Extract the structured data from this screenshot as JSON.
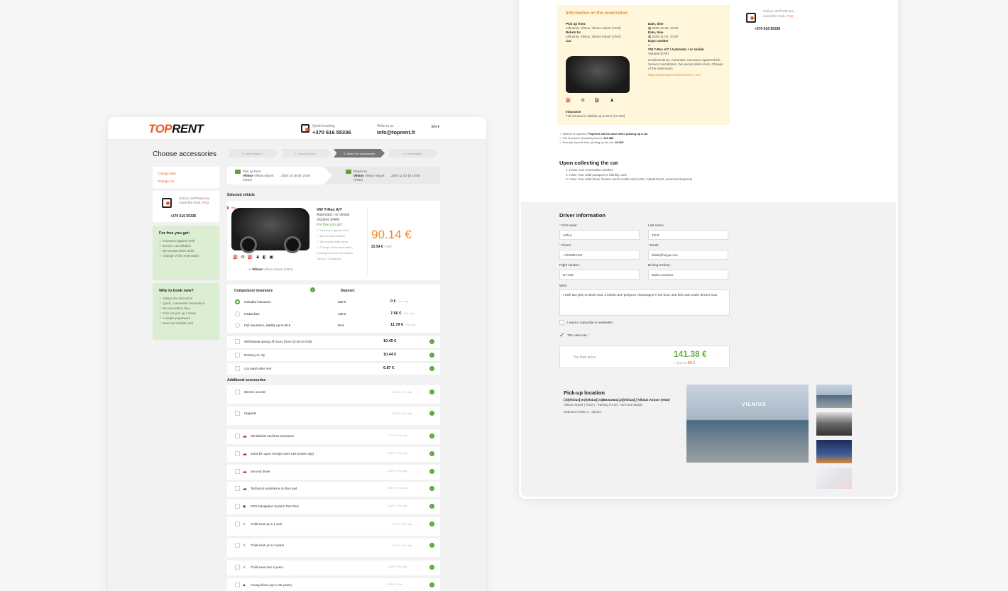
{
  "left": {
    "logo": {
      "a": "TOP",
      "b": "RENT"
    },
    "header": {
      "quick_label": "Quick booking",
      "quick_phone": "+370 616 55336",
      "write_label": "Write to us",
      "email": "info@toprent.lt",
      "lang": "EN ▾"
    },
    "page_title": "Choose accessories",
    "steps": [
      "1. Select dates ✓",
      "2. Choose a car ✓",
      "3. Select the accessories",
      "4. Confirmation"
    ],
    "side_links": [
      "Change date",
      "Change car"
    ],
    "call": {
      "text": "Call us, we'll help you round the clock.",
      "faq": "FAQ",
      "phone": "+370 616 55336"
    },
    "free": {
      "title": "For free you get:",
      "items": [
        "Insurance against theft",
        "Service cancellation",
        "We accept debit cards",
        "Change of the reservation"
      ]
    },
    "why": {
      "title": "Why to book now?",
      "items": [
        "Always the best price",
        "Quick, convenient reservation",
        "No reservation fees",
        "Fast car pick up / return",
        "A simple paperwork",
        "New and reliable cars"
      ]
    },
    "route": {
      "pick_label": "Pick up from:",
      "pick_city": "Vilnius",
      "pick_place": "Vilnius Airport (VNO)",
      "pick_date": "2020 10 29 @ 10:00",
      "ret_label": "Return to:",
      "ret_city": "Vilnius",
      "ret_place": "Vilnius Airport (VNO)",
      "ret_date": "2020 11 02 @ 10:00"
    },
    "selected_vehicle": "Selected vehicle",
    "vehicle": {
      "badge": "New",
      "name": "VW T-Roc A/T",
      "sub": "Automatic / or similar",
      "class": "Vidutinė (FAR)",
      "free_title": "For free you get:",
      "free_items": [
        "Insurance against theft",
        "Service cancellation",
        "We accept debit cards",
        "Change of the reservation"
      ],
      "more": "Looking for more information",
      "terms": "Terms & Conditions",
      "price": "90.14 €",
      "per_day": "22.54 €",
      "per_day_unit": "/ day",
      "place_city": "Vilnius",
      "place_name": "Vilnius Airport (VNO)"
    },
    "insurance": {
      "title": "Compulsory insurance",
      "deposit": "Deposit:",
      "rows": [
        {
          "name": "Included insurance",
          "dep": "380 €",
          "price": "0 €",
          "unit": "/ Per day"
        },
        {
          "name": "Partial ban",
          "dep": "190 €",
          "price": "7.66 €",
          "unit": "/ Per day"
        },
        {
          "name": "Full insurance, liability up to 60 €",
          "dep": "60 €",
          "price": "11.78 €",
          "unit": "/ Per day"
        }
      ]
    },
    "extras": [
      {
        "name": "Withdrawal during off hours (from 22:00 to 8:00)",
        "price": "10.45 €"
      },
      {
        "name": "Delivery to city",
        "price": "10.44 €"
      },
      {
        "name": "Car wash after rent",
        "price": "6.87 €"
      }
    ],
    "additional_title": "Additional accessories",
    "accessories": [
      {
        "name": "Electric scooter",
        "price": "8.49 €",
        "unit": "/ Per day"
      },
      {
        "name": "Upgrade",
        "price": "4.98 €",
        "unit": "/ Per day"
      },
      {
        "name": "Windshield and tires insurance",
        "price": "1.77 €",
        "unit": "/ Per day"
      },
      {
        "name": "Extra km upon receipt (over 130 km/per day)",
        "price": "1.55 €",
        "unit": "/ Per day"
      },
      {
        "name": "Second driver",
        "price": "1.96 €",
        "unit": "/ Per day"
      },
      {
        "name": "Technical assistance on the road",
        "price": "1.88 €",
        "unit": "/ Per day"
      },
      {
        "name": "GPS Navigation System Tom-Tom",
        "price": "1.44 €",
        "unit": "/ Per day"
      },
      {
        "name": "Child seat up to 1 year",
        "price": "2.24 €",
        "unit": "/ Per day"
      },
      {
        "name": "Child seat up to 4 years",
        "price": "2.44 €",
        "unit": "/ Per day"
      },
      {
        "name": "Child seat over 4 years",
        "price": "1.09 €",
        "unit": "/ Per day"
      },
      {
        "name": "Young driver (up to 25 years)",
        "price": "2.93 €",
        "unit": "/ Per"
      }
    ]
  },
  "right": {
    "info_title": "Information on the reservation",
    "pick_from_label": "Pick up from:",
    "pick_from": "Lithuania, Vilnius, Vilnius Airport (VNO)",
    "date1_label": "Date, time",
    "date1": "2020-10-29, 10:00",
    "return_label": "Return to:",
    "return_val": "Lithuania, Vilnius, Vilnius Airport (VNO)",
    "date2_label": "Date, time",
    "date2": "2020-11-02, 10:00",
    "car_label": "Car",
    "days_label": "Days number",
    "days": "4",
    "car_name": "VW T-Roc A/T / Automatic / or similar",
    "car_class": "Vidutinė (FAR)",
    "car_features": "Kondicionierius, Automatic, Insurance against theft, Service cancellation, We accept debit cards, Change of the reservation",
    "car_link": "https://www.toprent.lt/en/car/vw-t-roc/",
    "ins_label": "Insurance",
    "ins_val": "Full insurance, liability up to 60 € (47.12€)",
    "pay": [
      {
        "k": "Method of payment:",
        "v": "Payment will be done when picking up a car"
      },
      {
        "k": "The final price (including taxes):",
        "v": "141.38€"
      },
      {
        "k": "Security deposit when picking up the car:",
        "v": "60.00€"
      }
    ],
    "call": {
      "text": "Call us, we'll help you round the clock.",
      "faq": "FAQ",
      "phone": "+370 616 55336"
    },
    "collect_title": "Upon collecting the car",
    "collect": [
      "1. Know Your reservation number",
      "2. Have Your valid passport or identity card",
      "3. Have Your valid driver license and a credit card (VISA, MasterCard, American Express)"
    ],
    "driver_title": "Driver information",
    "first_label": "First name:",
    "first": "Arthur",
    "last_label": "Last name:",
    "last": "Third",
    "phone_label": "Phone:",
    "phone": "+3756541123",
    "email_label": "Email:",
    "email": "lalala@heyya.com",
    "flight_label": "Flight number:",
    "flight": "BT-465",
    "territory_label": "Driving territory:",
    "territory": "Baltic countries",
    "wish_label": "Wish:",
    "wish": "I wish two girls on back seat, 3 bottles don-perignon champagne in the boot, and 50k cash under drivers seat",
    "newsletter": "I want to subscribe to newsletter",
    "rules": "The rules met",
    "final_label": "The final price:",
    "final": "141.38 €",
    "deposit_label": "+ deposit",
    "deposit": "60 €",
    "pickup_title": "Pick-up location",
    "pickup_name": "[:lt]Vilnius[:en]Vilnius[:ru]Вильнюс[:pl]Vilnius[:] Vilnius Airport (VNO)",
    "pickup_addr": "Vilnius Airport ( VNO ) , Parking P4 tel. +370 616 55336",
    "pickup_street": "Rodunios kelias 1 , Vilnius.",
    "building_sign": "VILNIUS"
  }
}
